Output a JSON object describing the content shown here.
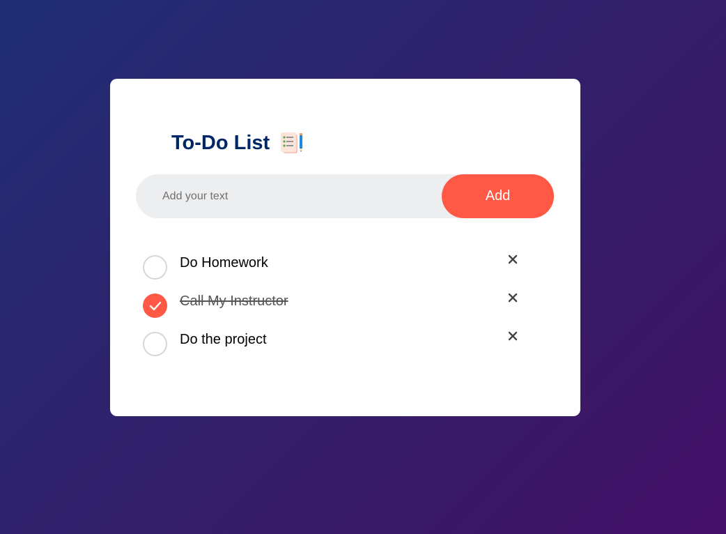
{
  "app": {
    "title": "To-Do List",
    "title_icon": "notepad-pencil-icon"
  },
  "input": {
    "value": "",
    "placeholder": "Add your text"
  },
  "add_button": {
    "label": "Add"
  },
  "tasks": [
    {
      "text": "Do Homework",
      "checked": false,
      "check_icon": "empty-circle-icon",
      "delete_icon": "close-icon"
    },
    {
      "text": "Call My Instructor",
      "checked": true,
      "check_icon": "checkmark-icon",
      "delete_icon": "close-icon"
    },
    {
      "text": "Do the project",
      "checked": false,
      "check_icon": "empty-circle-icon",
      "delete_icon": "close-icon"
    }
  ],
  "colors": {
    "accent": "#ff5945",
    "title": "#002765",
    "input_bg": "#edeef0",
    "card_bg": "#ffffff",
    "bg_gradient_start": "#1f2f75",
    "bg_gradient_end": "#45106a"
  }
}
